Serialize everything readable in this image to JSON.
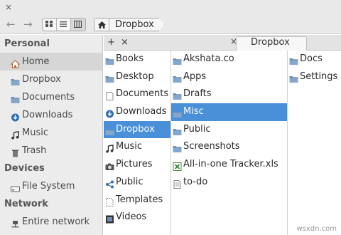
{
  "toolbar": {
    "back_glyph": "←",
    "forward_glyph": "→",
    "close_glyph": "×",
    "breadcrumb_home_icon": "home-icon",
    "breadcrumb_current": "Dropbox"
  },
  "tabbar": {
    "add_glyph": "+",
    "close_glyph": "×",
    "tab_close_glyph": "×",
    "active_tab": "Dropbox"
  },
  "sidebar": {
    "sections": [
      {
        "heading": "Personal",
        "items": [
          {
            "label": "Home",
            "icon": "home-icon",
            "selected": true
          },
          {
            "label": "Dropbox",
            "icon": "folder-icon"
          },
          {
            "label": "Documents",
            "icon": "folder-icon"
          },
          {
            "label": "Downloads",
            "icon": "download-icon"
          },
          {
            "label": "Music",
            "icon": "music-icon"
          },
          {
            "label": "Trash",
            "icon": "trash-icon"
          }
        ]
      },
      {
        "heading": "Devices",
        "items": [
          {
            "label": "File System",
            "icon": "drive-icon"
          }
        ]
      },
      {
        "heading": "Network",
        "items": [
          {
            "label": "Entire network",
            "icon": "network-icon"
          }
        ]
      }
    ]
  },
  "columns": [
    {
      "items": [
        {
          "label": "Books",
          "icon": "folder-icon"
        },
        {
          "label": "Desktop",
          "icon": "folder-icon"
        },
        {
          "label": "Documents",
          "icon": "document-icon"
        },
        {
          "label": "Downloads",
          "icon": "download-icon"
        },
        {
          "label": "Dropbox",
          "icon": "folder-icon",
          "selected": true
        },
        {
          "label": "Music",
          "icon": "music-icon"
        },
        {
          "label": "Pictures",
          "icon": "camera-icon"
        },
        {
          "label": "Public",
          "icon": "share-icon"
        },
        {
          "label": "Templates",
          "icon": "template-icon"
        },
        {
          "label": "Videos",
          "icon": "film-icon"
        }
      ]
    },
    {
      "items": [
        {
          "label": "Akshata.co",
          "icon": "folder-icon"
        },
        {
          "label": "Apps",
          "icon": "folder-icon"
        },
        {
          "label": "Drafts",
          "icon": "folder-icon"
        },
        {
          "label": "Misc",
          "icon": "folder-icon",
          "selected": true
        },
        {
          "label": "Public",
          "icon": "folder-icon"
        },
        {
          "label": "Screenshots",
          "icon": "folder-icon"
        },
        {
          "label": "All-in-one Tracker.xls",
          "icon": "spreadsheet-icon"
        },
        {
          "label": "to-do",
          "icon": "text-file-icon"
        }
      ]
    },
    {
      "items": [
        {
          "label": "Docs",
          "icon": "folder-icon"
        },
        {
          "label": "Settings",
          "icon": "folder-icon"
        }
      ]
    }
  ],
  "watermark": "wsxdn.com",
  "colors": {
    "selection": "#4a90d9",
    "folder": "#6c8fb5",
    "sidebar_bg": "#ececec"
  }
}
